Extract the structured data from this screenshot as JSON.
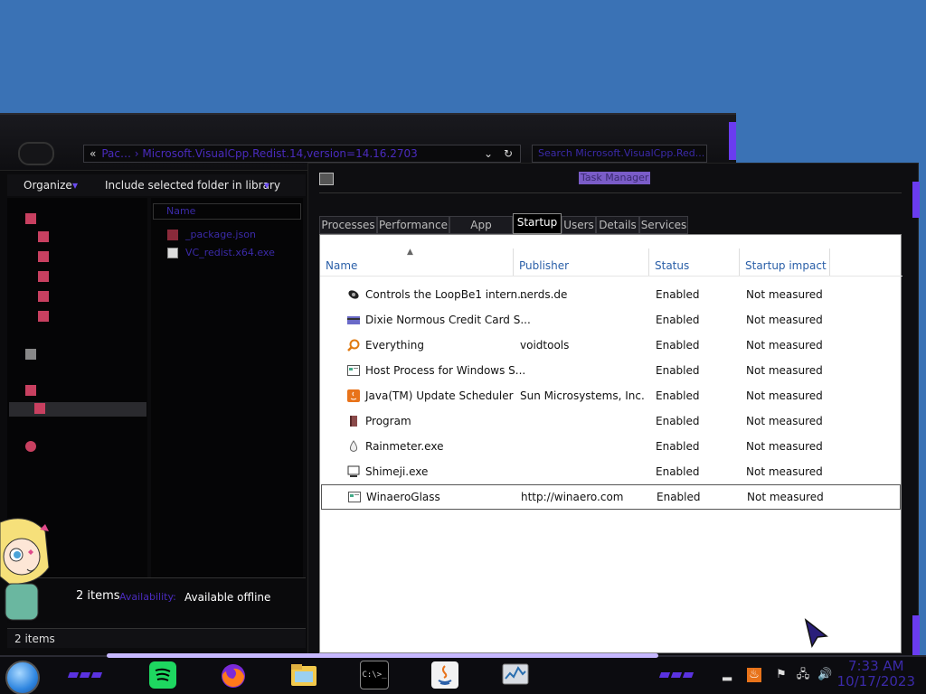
{
  "explorer": {
    "address_prefix": "«",
    "address_segments": "Pac…  ›  Microsoft.VisualCpp.Redist.14,version=14.16.2703",
    "search_placeholder": "Search Microsoft.VisualCpp.Red...",
    "organize_label": "Organize",
    "include_label": "Include selected folder in library",
    "column_name": "Name",
    "files": [
      {
        "name": "_package.json"
      },
      {
        "name": "VC_redist.x64.exe"
      }
    ],
    "details_count": "2 items",
    "availability_label": "Availability:",
    "availability_value": "Available offline",
    "status_count": "2 items"
  },
  "taskmanager": {
    "title": "Task Manager",
    "tabs": [
      "Processes",
      "Performance",
      "App history",
      "Startup",
      "Users",
      "Details",
      "Services"
    ],
    "active_tab": "Startup",
    "columns": [
      "Name",
      "Publisher",
      "Status",
      "Startup impact"
    ],
    "rows": [
      {
        "name": "Controls the LoopBe1 intern...",
        "publisher": "nerds.de",
        "status": "Enabled",
        "impact": "Not measured",
        "icon": "speaker-icon"
      },
      {
        "name": "Dixie Normous Credit Card S...",
        "publisher": "",
        "status": "Enabled",
        "impact": "Not measured",
        "icon": "card-icon"
      },
      {
        "name": "Everything",
        "publisher": "voidtools",
        "status": "Enabled",
        "impact": "Not measured",
        "icon": "magnifier-icon"
      },
      {
        "name": "Host Process for Windows S...",
        "publisher": "",
        "status": "Enabled",
        "impact": "Not measured",
        "icon": "window-icon"
      },
      {
        "name": "Java(TM) Update Scheduler",
        "publisher": "Sun Microsystems, Inc.",
        "status": "Enabled",
        "impact": "Not measured",
        "icon": "java-icon"
      },
      {
        "name": "Program",
        "publisher": "",
        "status": "Enabled",
        "impact": "Not measured",
        "icon": "book-icon"
      },
      {
        "name": "Rainmeter.exe",
        "publisher": "",
        "status": "Enabled",
        "impact": "Not measured",
        "icon": "drop-icon"
      },
      {
        "name": "Shimeji.exe",
        "publisher": "",
        "status": "Enabled",
        "impact": "Not measured",
        "icon": "monitor-icon"
      },
      {
        "name": "WinaeroGlass",
        "publisher": "http://winaero.com",
        "status": "Enabled",
        "impact": "Not measured",
        "icon": "window-icon"
      }
    ]
  },
  "taskbar": {
    "time": "7:33 AM",
    "date": "10/17/2023",
    "terminal_label": "C:\\>_"
  },
  "colors": {
    "accent_purple": "#5a32e0",
    "header_blue": "#2a5fa8",
    "desktop_blue": "#3a72b5"
  }
}
